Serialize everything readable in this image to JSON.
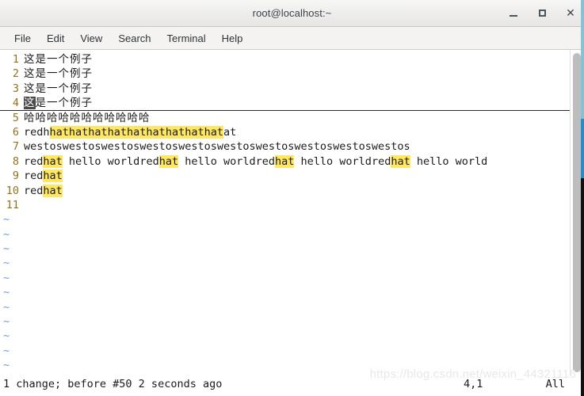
{
  "window": {
    "title": "root@localhost:~",
    "buttons": {
      "minimize": "minimize",
      "maximize": "maximize",
      "close": "✕"
    }
  },
  "menubar": {
    "items": [
      {
        "label": "File"
      },
      {
        "label": "Edit"
      },
      {
        "label": "View"
      },
      {
        "label": "Search"
      },
      {
        "label": "Terminal"
      },
      {
        "label": "Help"
      }
    ]
  },
  "editor": {
    "lines": [
      {
        "number": "1",
        "segments": [
          {
            "text": "这是一个例子",
            "style": "cjk"
          }
        ]
      },
      {
        "number": "2",
        "segments": [
          {
            "text": "这是一个例子",
            "style": "cjk"
          }
        ]
      },
      {
        "number": "3",
        "segments": [
          {
            "text": "这是一个例子",
            "style": "cjk"
          }
        ]
      },
      {
        "number": "4",
        "cursorline": true,
        "segments": [
          {
            "text": "这",
            "style": "cjk cursor-block"
          },
          {
            "text": "是一个例子",
            "style": "cjk"
          }
        ]
      },
      {
        "number": "5",
        "segments": [
          {
            "text": "哈哈哈哈哈哈哈哈哈哈哈",
            "style": "cjk"
          }
        ]
      },
      {
        "number": "6",
        "segments": [
          {
            "text": "redh",
            "style": ""
          },
          {
            "text": "hathathathathathathathathat",
            "style": "hl"
          },
          {
            "text": "at",
            "style": ""
          }
        ]
      },
      {
        "number": "7",
        "segments": [
          {
            "text": "westoswestoswestoswestoswestoswestoswestoswestoswestoswestos",
            "style": ""
          }
        ]
      },
      {
        "number": "8",
        "segments": [
          {
            "text": "red",
            "style": ""
          },
          {
            "text": "hat",
            "style": "hl"
          },
          {
            "text": " hello worldred",
            "style": ""
          },
          {
            "text": "hat",
            "style": "hl"
          },
          {
            "text": " hello worldred",
            "style": ""
          },
          {
            "text": "hat",
            "style": "hl"
          },
          {
            "text": " hello worldred",
            "style": ""
          },
          {
            "text": "hat",
            "style": "hl"
          },
          {
            "text": " hello world",
            "style": ""
          }
        ]
      },
      {
        "number": "9",
        "segments": [
          {
            "text": "red",
            "style": ""
          },
          {
            "text": "hat",
            "style": "hl"
          }
        ]
      },
      {
        "number": "10",
        "segments": [
          {
            "text": "red",
            "style": ""
          },
          {
            "text": "hat",
            "style": "hl"
          }
        ]
      },
      {
        "number": "11",
        "segments": [
          {
            "text": "",
            "style": ""
          }
        ]
      }
    ],
    "empty_marker": "~",
    "empty_marker_count": 12
  },
  "statusbar": {
    "message": "1 change; before #50  2 seconds ago",
    "position": "4,1",
    "scroll": "All"
  },
  "watermark": {
    "text": "https://blog.csdn.net/weixin_44321116"
  },
  "colors": {
    "highlight": "#ffe761",
    "line_number": "#96711b",
    "tilde": "#6f9fd8",
    "cursor_block": "#4a4a4a",
    "text": "#1b1b1b",
    "titlebar": "#eeedeb",
    "background": "#ffffff"
  }
}
